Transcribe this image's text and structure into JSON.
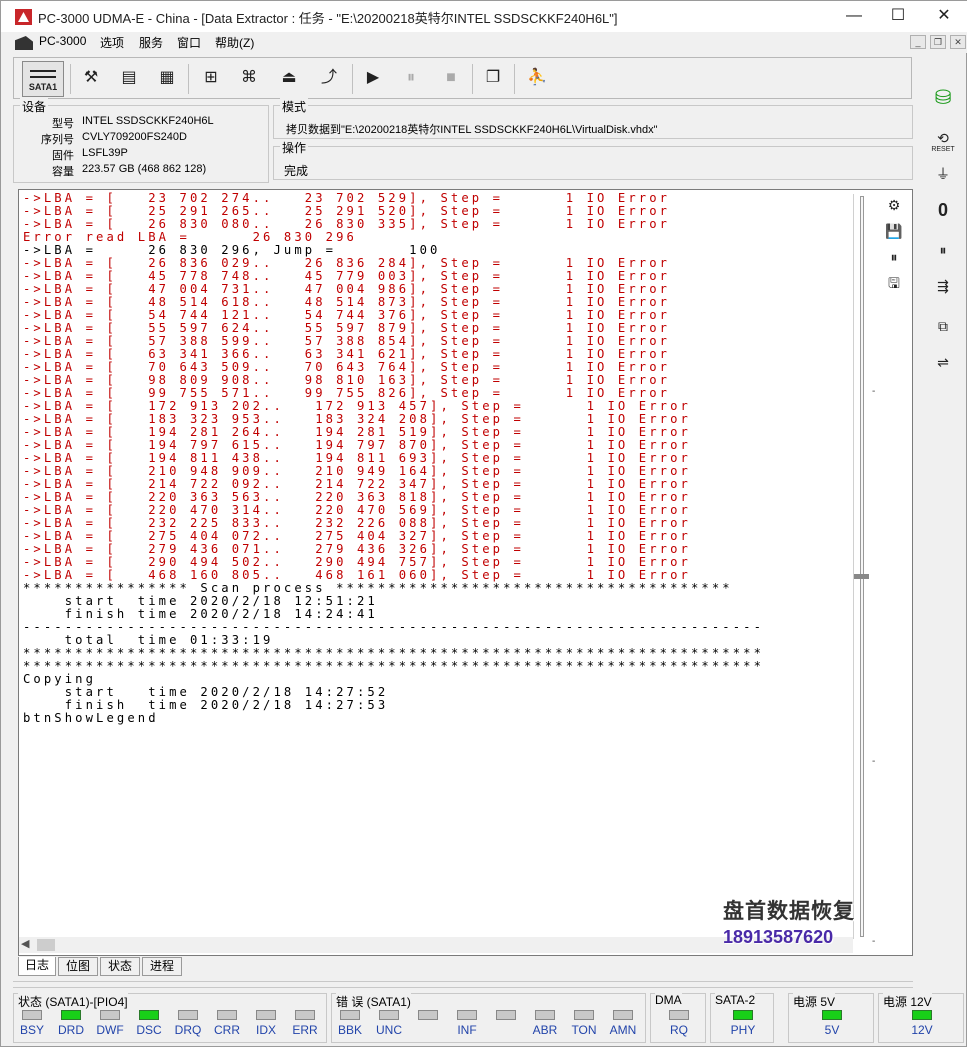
{
  "window": {
    "title": "PC-3000 UDMA-E - China - [Data Extractor : 任务 - \"E:\\20200218英特尔INTEL SSDSCKKF240H6L\"]",
    "minimize_glyph": "—",
    "maximize_glyph": "☐",
    "close_glyph": "✕"
  },
  "menu": {
    "items": [
      "PC-3000",
      "选项",
      "服务",
      "窗口",
      "帮助(Z)"
    ],
    "mdi_min": "_",
    "mdi_restore": "❐",
    "mdi_close": "✕"
  },
  "toolbar": {
    "sata_label": "SATA1",
    "icons": [
      "wrench-screwdriver-icon",
      "disk-map-icon",
      "percent-map-icon",
      "tree-icon",
      "binoculars-icon",
      "drive-stack-icon",
      "export-icon",
      "play-icon",
      "pause-icon",
      "stop-icon",
      "windows-icon",
      "run-icon"
    ],
    "glyphs": [
      "⚒",
      "▤",
      "▦",
      "⊞",
      "⌘",
      "⏏",
      "⤴",
      "▶",
      "⏸",
      "■",
      "❐",
      "⛹"
    ]
  },
  "rightbar": {
    "reset_label": "RESET",
    "glyphs": [
      "⛁",
      "⟲",
      "⏚",
      "0",
      "⏸",
      "⇶",
      "⧉",
      "⇌"
    ]
  },
  "device": {
    "group_label": "设备",
    "fields": [
      {
        "key": "型号",
        "value": "INTEL SSDSCKKF240H6L"
      },
      {
        "key": "序列号",
        "value": "CVLY709200FS240D"
      },
      {
        "key": "固件",
        "value": "LSFL39P"
      },
      {
        "key": "容量",
        "value": "223.57 GB (468 862 128)"
      }
    ]
  },
  "mode": {
    "group_label": "模式",
    "value": "拷贝数据到\"E:\\20200218英特尔INTEL SSDSCKKF240H6L\\VirtualDisk.vhdx\""
  },
  "operation": {
    "group_label": "操作",
    "value": "完成"
  },
  "log": {
    "lines": [
      {
        "t": "->LBA = [   23 702 274..   23 702 529], Step =      1 IO Error",
        "err": true
      },
      {
        "t": "->LBA = [   25 291 265..   25 291 520], Step =      1 IO Error",
        "err": true
      },
      {
        "t": "->LBA = [   26 830 080..   26 830 335], Step =      1 IO Error",
        "err": true
      },
      {
        "t": "Error read LBA =      26 830 296",
        "err": true
      },
      {
        "t": "->LBA =     26 830 296, Jump =       100",
        "err": false
      },
      {
        "t": "->LBA = [   26 836 029..   26 836 284], Step =      1 IO Error",
        "err": true
      },
      {
        "t": "->LBA = [   45 778 748..   45 779 003], Step =      1 IO Error",
        "err": true
      },
      {
        "t": "->LBA = [   47 004 731..   47 004 986], Step =      1 IO Error",
        "err": true
      },
      {
        "t": "->LBA = [   48 514 618..   48 514 873], Step =      1 IO Error",
        "err": true
      },
      {
        "t": "->LBA = [   54 744 121..   54 744 376], Step =      1 IO Error",
        "err": true
      },
      {
        "t": "->LBA = [   55 597 624..   55 597 879], Step =      1 IO Error",
        "err": true
      },
      {
        "t": "->LBA = [   57 388 599..   57 388 854], Step =      1 IO Error",
        "err": true
      },
      {
        "t": "->LBA = [   63 341 366..   63 341 621], Step =      1 IO Error",
        "err": true
      },
      {
        "t": "->LBA = [   70 643 509..   70 643 764], Step =      1 IO Error",
        "err": true
      },
      {
        "t": "->LBA = [   98 809 908..   98 810 163], Step =      1 IO Error",
        "err": true
      },
      {
        "t": "->LBA = [   99 755 571..   99 755 826], Step =      1 IO Error",
        "err": true
      },
      {
        "t": "->LBA = [   172 913 202..   172 913 457], Step =      1 IO Error",
        "err": true
      },
      {
        "t": "->LBA = [   183 323 953..   183 324 208], Step =      1 IO Error",
        "err": true
      },
      {
        "t": "->LBA = [   194 281 264..   194 281 519], Step =      1 IO Error",
        "err": true
      },
      {
        "t": "->LBA = [   194 797 615..   194 797 870], Step =      1 IO Error",
        "err": true
      },
      {
        "t": "->LBA = [   194 811 438..   194 811 693], Step =      1 IO Error",
        "err": true
      },
      {
        "t": "->LBA = [   210 948 909..   210 949 164], Step =      1 IO Error",
        "err": true
      },
      {
        "t": "->LBA = [   214 722 092..   214 722 347], Step =      1 IO Error",
        "err": true
      },
      {
        "t": "->LBA = [   220 363 563..   220 363 818], Step =      1 IO Error",
        "err": true
      },
      {
        "t": "->LBA = [   220 470 314..   220 470 569], Step =      1 IO Error",
        "err": true
      },
      {
        "t": "->LBA = [   232 225 833..   232 226 088], Step =      1 IO Error",
        "err": true
      },
      {
        "t": "->LBA = [   275 404 072..   275 404 327], Step =      1 IO Error",
        "err": true
      },
      {
        "t": "->LBA = [   279 436 071..   279 436 326], Step =      1 IO Error",
        "err": true
      },
      {
        "t": "->LBA = [   290 494 502..   290 494 757], Step =      1 IO Error",
        "err": true
      },
      {
        "t": "->LBA = [   468 160 805..   468 161 060], Step =      1 IO Error",
        "err": true
      },
      {
        "t": "**************** Scan process **************************************",
        "err": false
      },
      {
        "t": "    start  time 2020/2/18 12:51:21",
        "err": false
      },
      {
        "t": "    finish time 2020/2/18 14:24:41",
        "err": false
      },
      {
        "t": "-----------------------------------------------------------------------",
        "err": false
      },
      {
        "t": "    total  time 01:33:19",
        "err": false
      },
      {
        "t": "***********************************************************************",
        "err": false
      },
      {
        "t": "***********************************************************************",
        "err": false
      },
      {
        "t": "Copying",
        "err": false
      },
      {
        "t": "    start   time 2020/2/18 14:27:52",
        "err": false
      },
      {
        "t": "    finish  time 2020/2/18 14:27:53",
        "err": false
      },
      {
        "t": "btnShowLegend",
        "err": false
      }
    ],
    "tool_glyphs": [
      "⚙",
      "💾",
      "⏸",
      "🖫"
    ]
  },
  "tabs": [
    "日志",
    "位图",
    "状态",
    "进程"
  ],
  "status_groups": [
    {
      "label": "状态 (SATA1)-[PIO4]",
      "leds": [
        {
          "name": "BSY",
          "on": false
        },
        {
          "name": "DRD",
          "on": true
        },
        {
          "name": "DWF",
          "on": false
        },
        {
          "name": "DSC",
          "on": true
        },
        {
          "name": "DRQ",
          "on": false
        },
        {
          "name": "CRR",
          "on": false
        },
        {
          "name": "IDX",
          "on": false
        },
        {
          "name": "ERR",
          "on": false
        }
      ]
    },
    {
      "label": "错 误 (SATA1)",
      "leds": [
        {
          "name": "BBK",
          "on": false
        },
        {
          "name": "UNC",
          "on": false
        },
        {
          "name": "",
          "on": false
        },
        {
          "name": "INF",
          "on": false
        },
        {
          "name": "",
          "on": false
        },
        {
          "name": "ABR",
          "on": false
        },
        {
          "name": "TON",
          "on": false
        },
        {
          "name": "AMN",
          "on": false
        }
      ]
    },
    {
      "label": "DMA",
      "leds": [
        {
          "name": "RQ",
          "on": false
        }
      ]
    },
    {
      "label": "SATA-2",
      "leds": [
        {
          "name": "PHY",
          "on": true
        }
      ]
    },
    {
      "label": "电源 5V",
      "leds": [
        {
          "name": "5V",
          "on": true
        }
      ]
    },
    {
      "label": "电源 12V",
      "leds": [
        {
          "name": "12V",
          "on": true
        }
      ]
    }
  ],
  "watermark": {
    "line1": "盘首数据恢复",
    "line2": "18913587620"
  },
  "colors": {
    "error_text": "#c00000",
    "led_on": "#18d018",
    "led_off": "#c8c8c8"
  }
}
